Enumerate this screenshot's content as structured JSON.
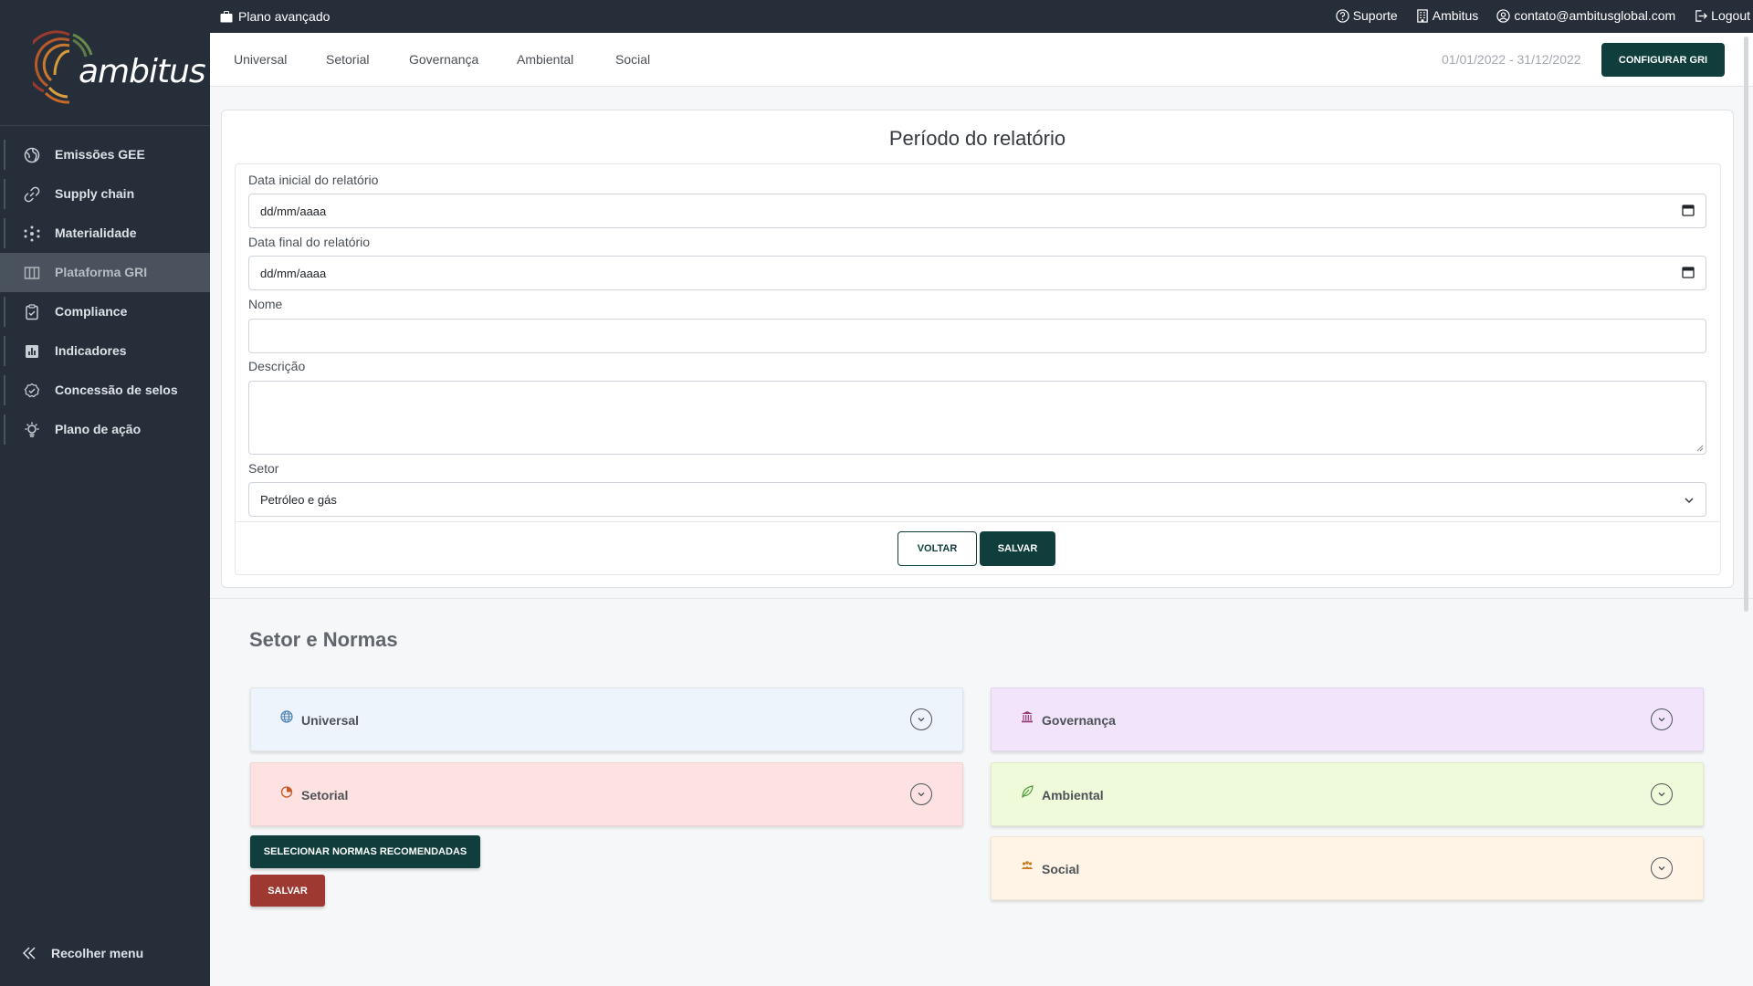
{
  "brand": {
    "name": "ambitus",
    "accent": "#0f3e3c",
    "danger": "#9d3931",
    "sidebar_bg": "#262e39"
  },
  "topbar": {
    "plan": "Plano avançado",
    "support": "Suporte",
    "company": "Ambitus",
    "email": "contato@ambitusglobal.com",
    "logout": "Logout"
  },
  "sidebar": {
    "items": [
      {
        "label": "Emissões GEE",
        "icon": "globe-icon"
      },
      {
        "label": "Supply chain",
        "icon": "link-icon"
      },
      {
        "label": "Materialidade",
        "icon": "network-icon"
      },
      {
        "label": "Plataforma GRI",
        "icon": "columns-icon",
        "active": true
      },
      {
        "label": "Compliance",
        "icon": "clipboard-check-icon"
      },
      {
        "label": "Indicadores",
        "icon": "bar-chart-icon"
      },
      {
        "label": "Concessão de selos",
        "icon": "badge-check-icon"
      },
      {
        "label": "Plano de ação",
        "icon": "lightbulb-icon"
      }
    ],
    "collapse": "Recolher menu"
  },
  "tabs": [
    "Universal",
    "Setorial",
    "Governança",
    "Ambiental",
    "Social"
  ],
  "period": "01/01/2022 - 31/12/2022",
  "configure_button": "CONFIGURAR GRI",
  "form": {
    "title": "Período do relatório",
    "start_label": "Data inicial do relatório",
    "start_value": "dd/mm/aaaa",
    "end_label": "Data final do relatório",
    "end_value": "dd/mm/aaaa",
    "name_label": "Nome",
    "name_value": "",
    "desc_label": "Descrição",
    "desc_value": "",
    "sector_label": "Setor",
    "sector_value": "Petróleo e gás",
    "back_button": "VOLTAR",
    "save_button": "SALVAR"
  },
  "norms": {
    "title": "Setor e Normas",
    "left": [
      {
        "label": "Universal",
        "icon": "globe-icon",
        "bg": "#eef4fb",
        "icon_color": "#4a7fb5"
      },
      {
        "label": "Setorial",
        "icon": "pie-chart-icon",
        "bg": "#fde2e1",
        "icon_color": "#c45a2a"
      }
    ],
    "right": [
      {
        "label": "Governança",
        "icon": "bank-icon",
        "bg": "#f1e4fb",
        "icon_color": "#9b3a7a"
      },
      {
        "label": "Ambiental",
        "icon": "leaf-icon",
        "bg": "#eefad9",
        "icon_color": "#4f9a3a"
      },
      {
        "label": "Social",
        "icon": "people-icon",
        "bg": "#fff4e6",
        "icon_color": "#c87a1e"
      }
    ],
    "recommend_button": "SELECIONAR NORMAS RECOMENDADAS",
    "save_button": "SALVAR"
  }
}
